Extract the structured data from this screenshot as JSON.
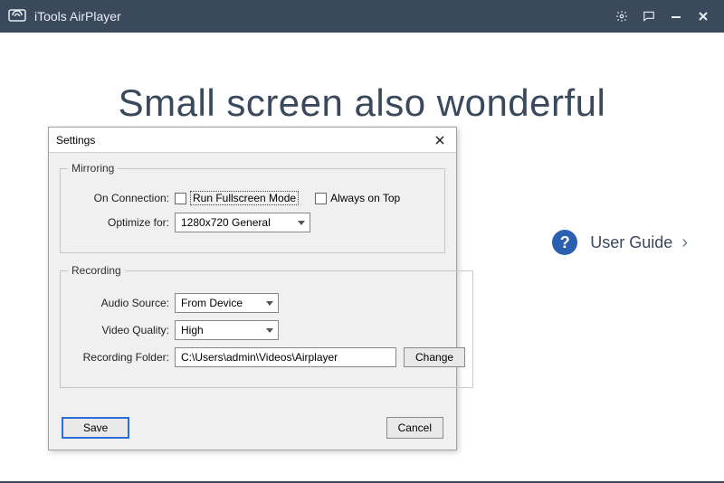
{
  "titlebar": {
    "appName": "iTools AirPlayer"
  },
  "main": {
    "heroText": "Small screen also wonderful",
    "userGuideLabel": "User Guide"
  },
  "dialog": {
    "title": "Settings",
    "mirroring": {
      "legend": "Mirroring",
      "onConnectionLabel": "On Connection:",
      "runFullscreenLabel": "Run Fullscreen Mode",
      "alwaysOnTopLabel": "Always on Top",
      "optimizeForLabel": "Optimize for:",
      "optimizeForValue": "1280x720 General"
    },
    "recording": {
      "legend": "Recording",
      "audioSourceLabel": "Audio Source:",
      "audioSourceValue": "From Device",
      "videoQualityLabel": "Video Quality:",
      "videoQualityValue": "High",
      "recordingFolderLabel": "Recording Folder:",
      "recordingFolderValue": "C:\\Users\\admin\\Videos\\Airplayer",
      "changeLabel": "Change"
    },
    "saveLabel": "Save",
    "cancelLabel": "Cancel"
  }
}
